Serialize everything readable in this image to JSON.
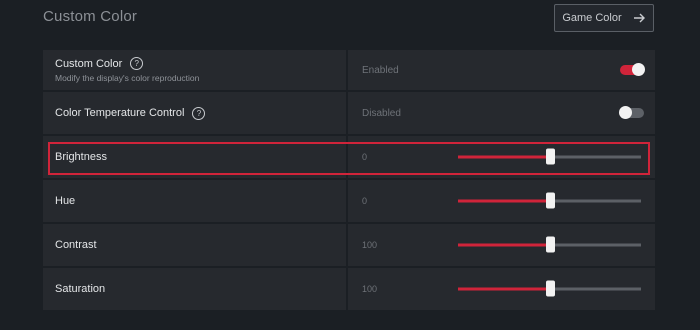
{
  "header": {
    "title": "Custom Color",
    "game_color_button": "Game Color"
  },
  "rows": [
    {
      "label": "Custom Color",
      "sub": "Modify the display's color reproduction",
      "value": "Enabled",
      "toggle": "on"
    },
    {
      "label": "Color Temperature Control",
      "value": "Disabled",
      "toggle": "off"
    },
    {
      "label": "Brightness",
      "value": "0",
      "slider": 0.5
    },
    {
      "label": "Hue",
      "value": "0",
      "slider": 0.5
    },
    {
      "label": "Contrast",
      "value": "100",
      "slider": 0.5
    },
    {
      "label": "Saturation",
      "value": "100",
      "slider": 0.5
    }
  ],
  "icons": {
    "help": "help-circle-icon",
    "arrow": "arrow-right-icon"
  },
  "colors": {
    "accent": "#d0243a",
    "background": "#1b1f24",
    "panel": "#26292e"
  }
}
